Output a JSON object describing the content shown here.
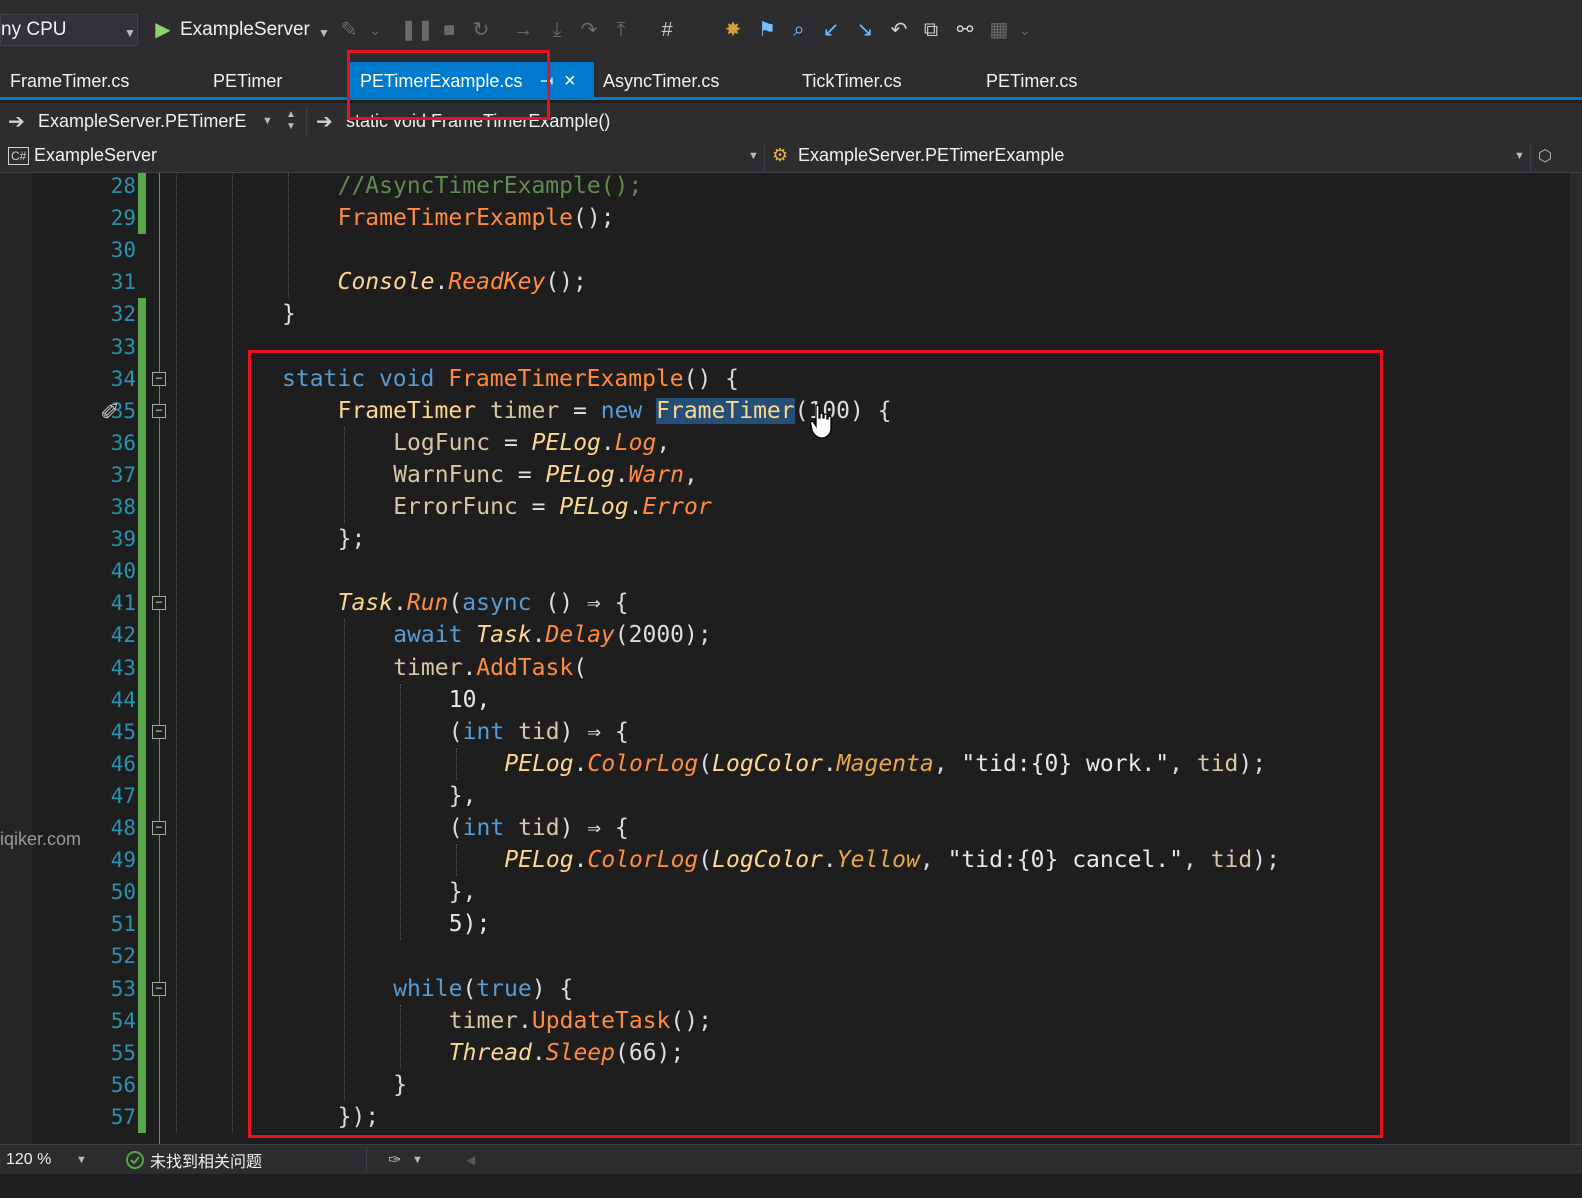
{
  "toolbar": {
    "platform": "ny CPU",
    "start_target": "ExampleServer"
  },
  "tabs": [
    {
      "label": "FrameTimer.cs",
      "active": false
    },
    {
      "label": "PETimer",
      "active": false
    },
    {
      "label": "PETimerExample.cs",
      "active": true
    },
    {
      "label": "AsyncTimer.cs",
      "active": false
    },
    {
      "label": "TickTimer.cs",
      "active": false
    },
    {
      "label": "PETimer.cs",
      "active": false
    }
  ],
  "tab_close_glyph": "×",
  "tab_pin_glyph": "⇥",
  "nav": {
    "type_scope": "ExampleServer.PETimerE",
    "member": "static void FrameTimerExample()",
    "project": "ExampleServer",
    "class_scope": "ExampleServer.PETimerExample"
  },
  "editor": {
    "line_numbers": [
      "28",
      "29",
      "30",
      "31",
      "32",
      "33",
      "34",
      "35",
      "36",
      "37",
      "38",
      "39",
      "40",
      "41",
      "42",
      "43",
      "44",
      "45",
      "46",
      "47",
      "48",
      "49",
      "50",
      "51",
      "52",
      "53",
      "54",
      "55",
      "56",
      "57"
    ],
    "code_lines": [
      "//AsyncTimerExample();",
      "FrameTimerExample();",
      "",
      "Console.ReadKey();",
      "}",
      "",
      "static void FrameTimerExample() {",
      "FrameTimer timer = new FrameTimer(100) {",
      "LogFunc = PELog.Log,",
      "WarnFunc = PELog.Warn,",
      "ErrorFunc = PELog.Error",
      "};",
      "",
      "Task.Run(async () ⇒ {",
      "await Task.Delay(2000);",
      "timer.AddTask(",
      "10,",
      "(int tid) ⇒ {",
      "PELog.ColorLog(LogColor.Magenta, \"tid:{0} work.\", tid);",
      "},",
      "(int tid) ⇒ {",
      "PELog.ColorLog(LogColor.Yellow, \"tid:{0} cancel.\", tid);",
      "},",
      "5);",
      "",
      "while(true) {",
      "timer.UpdateTask();",
      "Thread.Sleep(66);",
      "}",
      "});"
    ]
  },
  "watermark": "iqiker.com",
  "status": {
    "zoom": "120 %",
    "issues": "未找到相关问题"
  }
}
